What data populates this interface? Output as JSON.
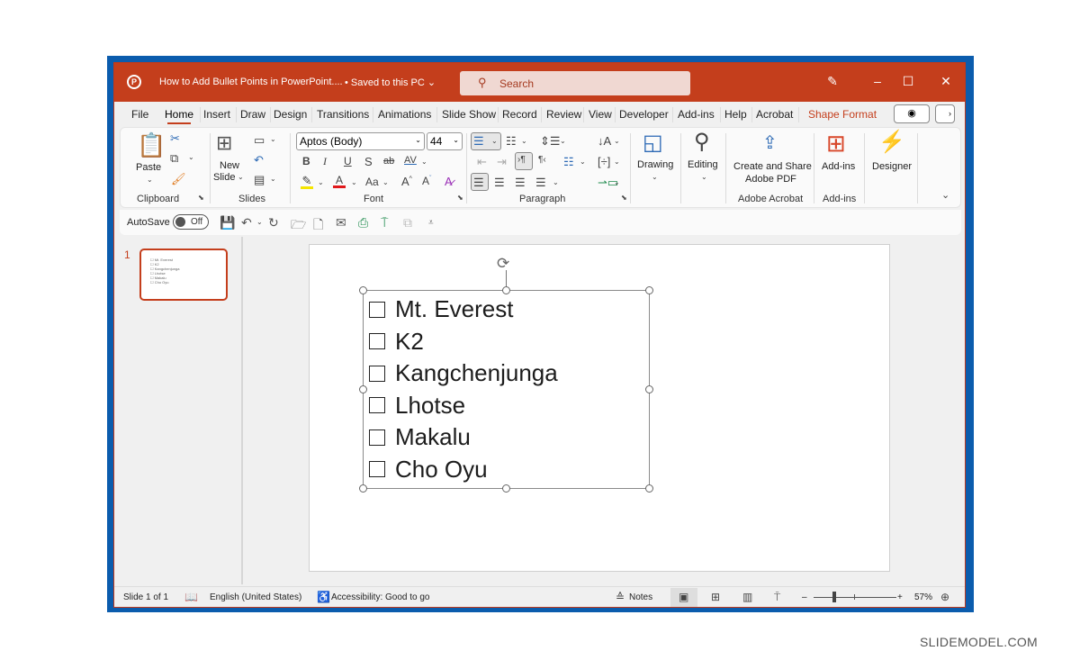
{
  "window": {
    "doc_title": "How to Add Bullet Points in PowerPoint....",
    "save_status": "• Saved to this PC",
    "search_placeholder": "Search",
    "accent_color": "#c43e1c"
  },
  "tabs": [
    "File",
    "Home",
    "Insert",
    "Draw",
    "Design",
    "Transitions",
    "Animations",
    "Slide Show",
    "Record",
    "Review",
    "View",
    "Developer",
    "Add-ins",
    "Help",
    "Acrobat",
    "Shape Format"
  ],
  "active_tab": "Home",
  "ribbon": {
    "clipboard": {
      "paste": "Paste",
      "label": "Clipboard"
    },
    "slides": {
      "new_slide_1": "New",
      "new_slide_2": "Slide",
      "label": "Slides"
    },
    "font": {
      "name": "Aptos (Body)",
      "size": "44",
      "bold": "B",
      "italic": "I",
      "underline": "U",
      "shadow": "S",
      "strike": "ab",
      "spacing": "AV",
      "change_case": "Aa",
      "grow": "A",
      "shrink": "A",
      "label": "Font"
    },
    "paragraph": {
      "label": "Paragraph"
    },
    "drawing": {
      "label": "Drawing"
    },
    "editing": {
      "label": "Editing"
    },
    "acrobat": {
      "btn_line1": "Create and Share",
      "btn_line2": "Adobe PDF",
      "label": "Adobe Acrobat"
    },
    "addins": {
      "btn": "Add-ins",
      "label": "Add-ins"
    },
    "designer": {
      "btn": "Designer"
    }
  },
  "qat": {
    "autosave_label": "AutoSave",
    "autosave_state": "Off"
  },
  "thumbnails": [
    {
      "number": "1",
      "lines": [
        "Mt. Everest",
        "K2",
        "Kangchenjunga",
        "Lhotse",
        "Makalu",
        "Cho Oyu"
      ]
    }
  ],
  "slide": {
    "items": [
      "Mt. Everest",
      "K2",
      "Kangchenjunga",
      "Lhotse",
      "Makalu",
      "Cho Oyu"
    ]
  },
  "status": {
    "slide_counter": "Slide 1 of 1",
    "language": "English (United States)",
    "accessibility": "Accessibility: Good to go",
    "notes": "Notes",
    "zoom_percent": "57%",
    "zoom_level": 57
  },
  "watermark": "SLIDEMODEL.COM"
}
